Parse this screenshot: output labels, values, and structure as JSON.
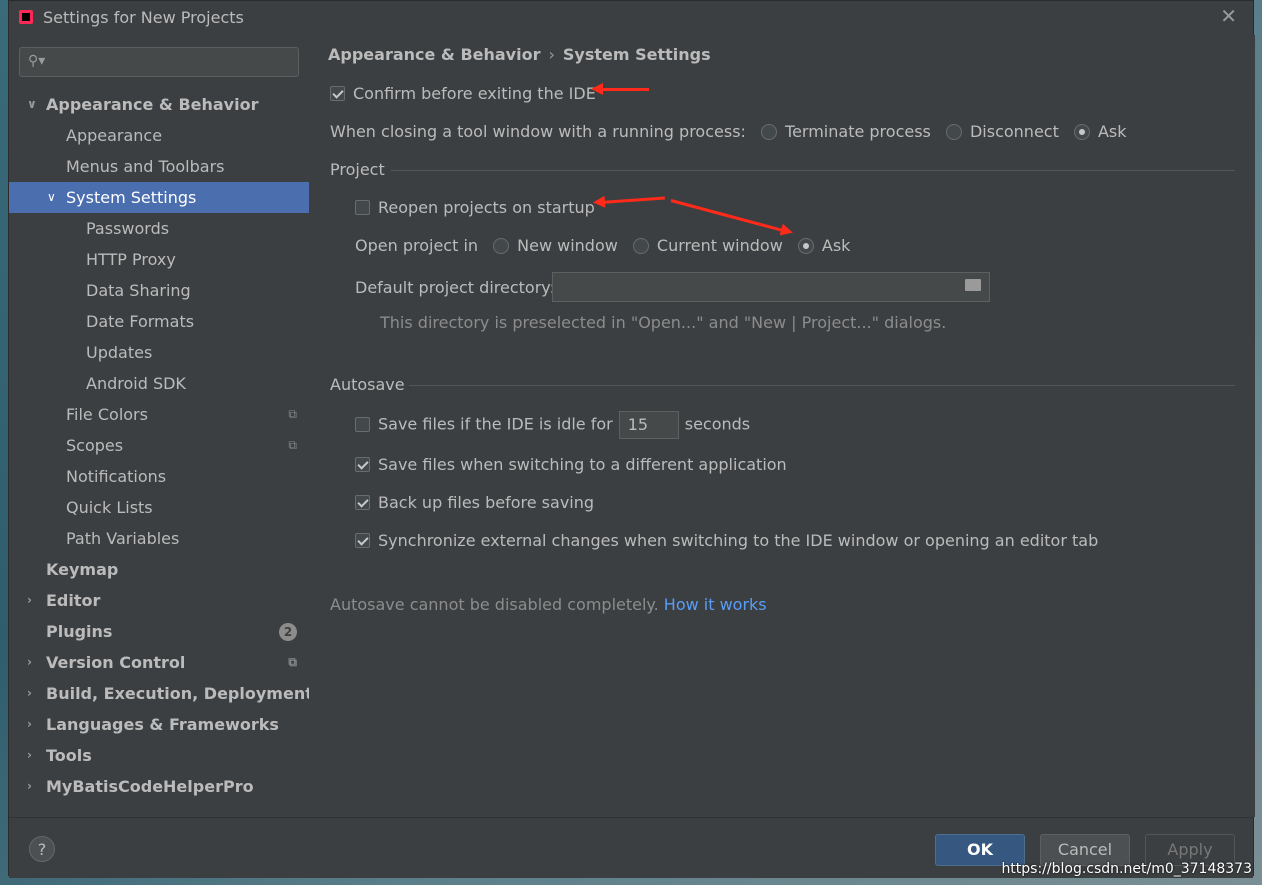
{
  "window": {
    "title": "Settings for New Projects"
  },
  "sidebar": {
    "search_placeholder": "",
    "items": [
      {
        "label": "Appearance & Behavior"
      },
      {
        "label": "Appearance"
      },
      {
        "label": "Menus and Toolbars"
      },
      {
        "label": "System Settings"
      },
      {
        "label": "Passwords"
      },
      {
        "label": "HTTP Proxy"
      },
      {
        "label": "Data Sharing"
      },
      {
        "label": "Date Formats"
      },
      {
        "label": "Updates"
      },
      {
        "label": "Android SDK"
      },
      {
        "label": "File Colors"
      },
      {
        "label": "Scopes"
      },
      {
        "label": "Notifications"
      },
      {
        "label": "Quick Lists"
      },
      {
        "label": "Path Variables"
      },
      {
        "label": "Keymap"
      },
      {
        "label": "Editor"
      },
      {
        "label": "Plugins",
        "badge": "2"
      },
      {
        "label": "Version Control"
      },
      {
        "label": "Build, Execution, Deployment"
      },
      {
        "label": "Languages & Frameworks"
      },
      {
        "label": "Tools"
      },
      {
        "label": "MyBatisCodeHelperPro"
      }
    ]
  },
  "breadcrumb": {
    "parent": "Appearance & Behavior",
    "sep": "›",
    "current": "System Settings"
  },
  "general": {
    "confirm_exit": {
      "label": "Confirm before exiting the IDE",
      "checked": true
    },
    "closing_label": "When closing a tool window with a running process:",
    "closing_options": [
      "Terminate process",
      "Disconnect",
      "Ask"
    ],
    "closing_selected": "Ask"
  },
  "project": {
    "section": "Project",
    "reopen": {
      "label": "Reopen projects on startup",
      "checked": false
    },
    "open_in_label": "Open project in",
    "open_in_options": [
      "New window",
      "Current window",
      "Ask"
    ],
    "open_in_selected": "Ask",
    "dir_label": "Default project directory:",
    "dir_value": "",
    "dir_hint": "This directory is preselected in \"Open...\" and \"New | Project...\" dialogs."
  },
  "autosave": {
    "section": "Autosave",
    "idle_label": "Save files if the IDE is idle for",
    "idle_value": "15",
    "idle_unit": "seconds",
    "idle_checked": false,
    "switch_app": "Save files when switching to a different application",
    "backup": "Back up files before saving",
    "sync": "Synchronize external changes when switching to the IDE window or opening an editor tab",
    "note": "Autosave cannot be disabled completely.",
    "link": "How it works"
  },
  "footer": {
    "help": "?",
    "ok": "OK",
    "cancel": "Cancel",
    "apply": "Apply"
  },
  "watermark": "https://blog.csdn.net/m0_37148373",
  "colors": {
    "selection": "#4b6eaf",
    "ok_button": "#365880",
    "link": "#589df6",
    "annotation_arrow": "#ff2a1a"
  }
}
